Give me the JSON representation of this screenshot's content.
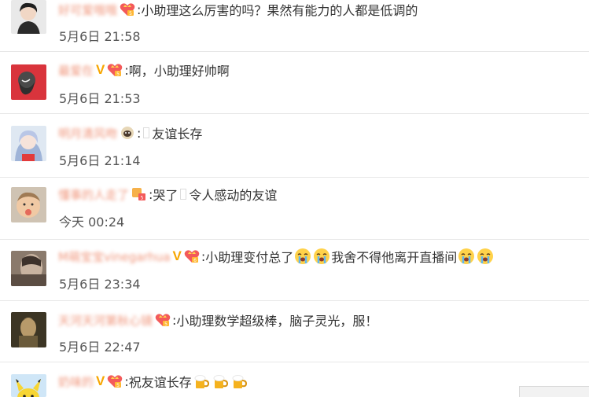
{
  "comments": [
    {
      "username": "好可爱哦哦",
      "colon": ":",
      "text_parts": [
        "小助理这么厉害的吗？果然有能力的人都是低调的"
      ],
      "time": "5月6日 21:58"
    },
    {
      "username": "最爱在",
      "colon": ":",
      "text_parts": [
        "啊，小助理好帅啊"
      ],
      "time": "5月6日 21:53"
    },
    {
      "username": "明月清风吻",
      "colon": ":",
      "text_parts": [
        "友谊长存"
      ],
      "time": "5月6日 21:14"
    },
    {
      "username": "懂事的人走了",
      "colon": ":",
      "text_parts": [
        "哭了",
        "令人感动的友谊"
      ],
      "time": "今天 00:24"
    },
    {
      "username": "M萌宝宝vinegarhua",
      "colon": ":",
      "text_parts": [
        "小助理变付总了",
        "我舍不得他离开直播间"
      ],
      "time": "5月6日 23:34"
    },
    {
      "username": "天河天河第秋心镜",
      "colon": ":",
      "text_parts": [
        "小助理数学超级棒，脑子灵光，服！"
      ],
      "time": "5月6日 22:47"
    },
    {
      "username": "奶味的",
      "colon": ":",
      "text_parts": [
        "祝友谊长存"
      ],
      "time": ""
    }
  ],
  "icons": {
    "member_badge": "crown-heart-badge-icon",
    "verified": "V",
    "cry_emoji": "crying-face-emoji",
    "beer_emoji": "beer-mug-emoji",
    "sheep_badge": "sheep-badge-icon"
  },
  "colors": {
    "username": "#eb7350",
    "text": "#333333",
    "time": "#555555",
    "verified": "#f7a600",
    "divider": "#e7e7e7"
  }
}
